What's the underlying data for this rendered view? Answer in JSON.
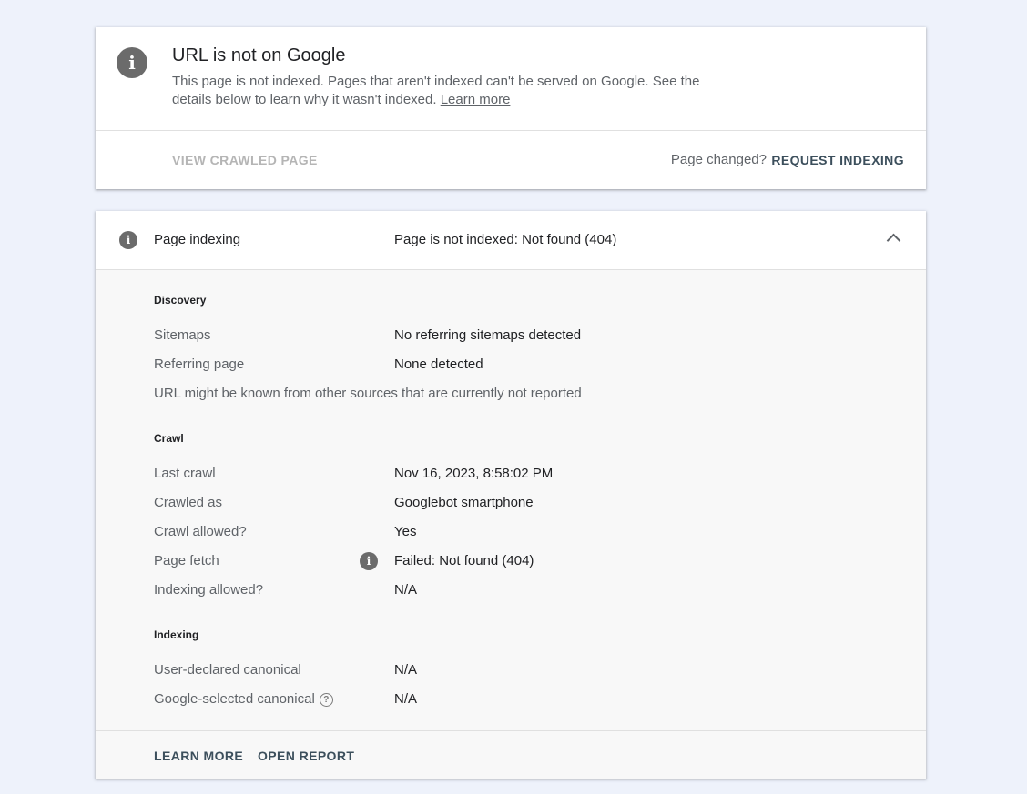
{
  "status": {
    "title": "URL is not on Google",
    "description": "This page is not indexed. Pages that aren't indexed can't be served on Google. See the details below to learn why it wasn't indexed.",
    "learn_more_link": "Learn more",
    "view_crawled_label": "VIEW CRAWLED PAGE",
    "page_changed_label": "Page changed?",
    "request_indexing_label": "REQUEST INDEXING",
    "icon": "info-icon"
  },
  "detail": {
    "header_label": "Page indexing",
    "header_value": "Page is not indexed: Not found (404)",
    "sections": {
      "discovery": {
        "title": "Discovery",
        "sitemaps_label": "Sitemaps",
        "sitemaps_value": "No referring sitemaps detected",
        "referring_label": "Referring page",
        "referring_value": "None detected",
        "note": "URL might be known from other sources that are currently not reported"
      },
      "crawl": {
        "title": "Crawl",
        "last_crawl_label": "Last crawl",
        "last_crawl_value": "Nov 16, 2023, 8:58:02 PM",
        "crawled_as_label": "Crawled as",
        "crawled_as_value": "Googlebot smartphone",
        "crawl_allowed_label": "Crawl allowed?",
        "crawl_allowed_value": "Yes",
        "page_fetch_label": "Page fetch",
        "page_fetch_value": "Failed: Not found (404)",
        "indexing_allowed_label": "Indexing allowed?",
        "indexing_allowed_value": "N/A"
      },
      "indexing": {
        "title": "Indexing",
        "user_canonical_label": "User-declared canonical",
        "user_canonical_value": "N/A",
        "google_canonical_label": "Google-selected canonical",
        "google_canonical_value": "N/A"
      }
    },
    "footer": {
      "learn_more_label": "LEARN MORE",
      "open_report_label": "OPEN REPORT"
    }
  },
  "colors": {
    "background": "#eef2fb",
    "card": "#ffffff",
    "card_body": "#f8f8f8",
    "accent_button": "#3c4f5c",
    "icon_gray": "#6b6b6b"
  }
}
